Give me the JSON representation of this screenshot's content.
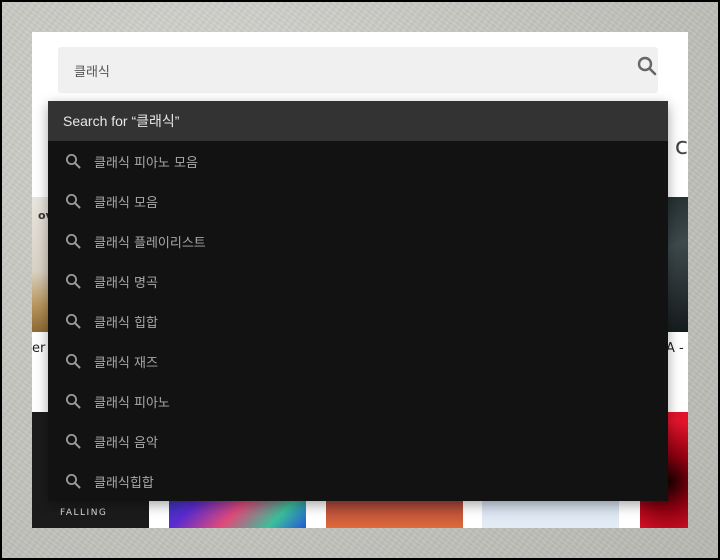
{
  "search": {
    "value": "클래식",
    "icon": "search-icon"
  },
  "dropdown": {
    "header_label": "Search for “클래식”",
    "suggestion_icon": "search-icon",
    "suggestions": [
      {
        "label": "클래식 피아노 모음"
      },
      {
        "label": "클래식 모음"
      },
      {
        "label": "클래식 플레이리스트"
      },
      {
        "label": "클래식 명곡"
      },
      {
        "label": "클래식 힙합"
      },
      {
        "label": "클래식 재즈"
      },
      {
        "label": "클래식 피아노"
      },
      {
        "label": "클래식 음악"
      },
      {
        "label": "클래식힙합"
      }
    ]
  },
  "background": {
    "heading_fragment": "d c",
    "tile_left_text": "ov",
    "caption_left": "er",
    "caption_right": "A -",
    "tile_falling_text": "FALLING"
  },
  "colors": {
    "dropdown_bg": "#121212",
    "dropdown_header_bg": "#333333",
    "search_bg": "#f0f0f0"
  }
}
